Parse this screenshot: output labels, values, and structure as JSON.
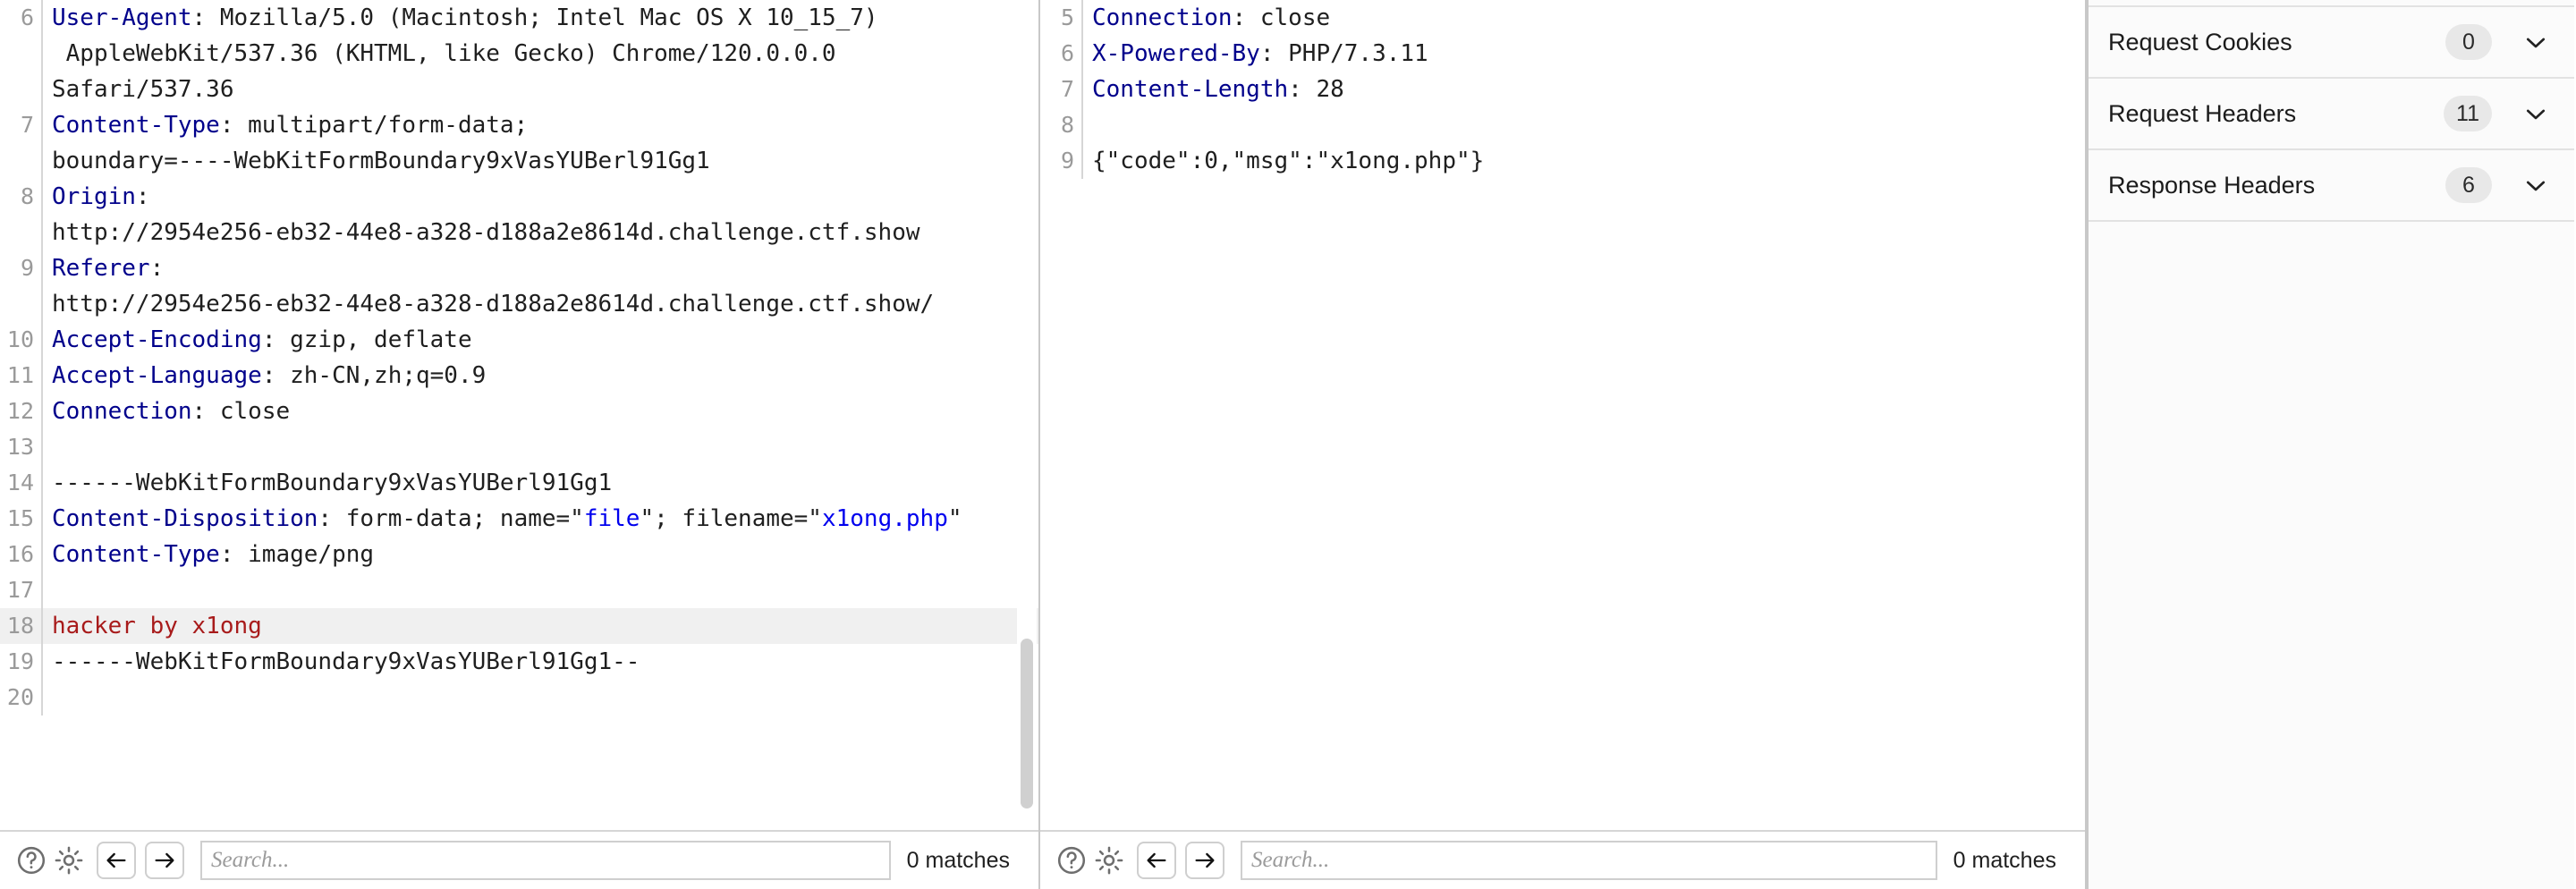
{
  "request_pane": {
    "lines": [
      {
        "num": "6",
        "segments": [
          {
            "t": "User-Agent",
            "c": "hdr"
          },
          {
            "t": ": Mozilla/5.0 (Macintosh; Intel Mac OS X 10_15_7)\n AppleWebKit/537.36 (KHTML, like Gecko) Chrome/120.0.0.0\nSafari/537.36",
            "c": "plain"
          }
        ]
      },
      {
        "num": "7",
        "segments": [
          {
            "t": "Content-Type",
            "c": "hdr"
          },
          {
            "t": ": multipart/form-data;\nboundary=----WebKitFormBoundary9xVasYUBerl91Gg1",
            "c": "plain"
          }
        ]
      },
      {
        "num": "8",
        "segments": [
          {
            "t": "Origin",
            "c": "hdr"
          },
          {
            "t": ":\nhttp://2954e256-eb32-44e8-a328-d188a2e8614d.challenge.ctf.show",
            "c": "plain"
          }
        ]
      },
      {
        "num": "9",
        "segments": [
          {
            "t": "Referer",
            "c": "hdr"
          },
          {
            "t": ":\nhttp://2954e256-eb32-44e8-a328-d188a2e8614d.challenge.ctf.show/",
            "c": "plain"
          }
        ]
      },
      {
        "num": "10",
        "segments": [
          {
            "t": "Accept-Encoding",
            "c": "hdr"
          },
          {
            "t": ": gzip, deflate",
            "c": "plain"
          }
        ]
      },
      {
        "num": "11",
        "segments": [
          {
            "t": "Accept-Language",
            "c": "hdr"
          },
          {
            "t": ": zh-CN,zh;q=0.9",
            "c": "plain"
          }
        ]
      },
      {
        "num": "12",
        "segments": [
          {
            "t": "Connection",
            "c": "hdr"
          },
          {
            "t": ": close",
            "c": "plain"
          }
        ]
      },
      {
        "num": "13",
        "segments": [
          {
            "t": "",
            "c": "plain"
          }
        ]
      },
      {
        "num": "14",
        "segments": [
          {
            "t": "------WebKitFormBoundary9xVasYUBerl91Gg1",
            "c": "plain"
          }
        ]
      },
      {
        "num": "15",
        "segments": [
          {
            "t": "Content-Disposition",
            "c": "hdr"
          },
          {
            "t": ": form-data; name=\"",
            "c": "plain"
          },
          {
            "t": "file",
            "c": "str"
          },
          {
            "t": "\"; filename=\"",
            "c": "plain"
          },
          {
            "t": "x1ong.php",
            "c": "str"
          },
          {
            "t": "\"",
            "c": "plain"
          }
        ]
      },
      {
        "num": "16",
        "segments": [
          {
            "t": "Content-Type",
            "c": "hdr"
          },
          {
            "t": ": image/png",
            "c": "plain"
          }
        ]
      },
      {
        "num": "17",
        "segments": [
          {
            "t": "",
            "c": "plain"
          }
        ]
      },
      {
        "num": "18",
        "highlight": true,
        "segments": [
          {
            "t": "hacker by x1ong",
            "c": "red"
          }
        ]
      },
      {
        "num": "19",
        "segments": [
          {
            "t": "------WebKitFormBoundary9xVasYUBerl91Gg1--",
            "c": "plain"
          }
        ]
      },
      {
        "num": "20",
        "segments": [
          {
            "t": "",
            "c": "plain"
          }
        ]
      }
    ],
    "toolbar": {
      "help_icon": "question-circle-icon",
      "settings_icon": "gear-icon",
      "prev_icon": "arrow-left-icon",
      "next_icon": "arrow-right-icon",
      "search_placeholder": "Search...",
      "search_value": "",
      "matches_label": "0 matches"
    }
  },
  "response_pane": {
    "lines": [
      {
        "num": "5",
        "segments": [
          {
            "t": "Connection",
            "c": "hdr"
          },
          {
            "t": ": close",
            "c": "plain"
          }
        ]
      },
      {
        "num": "6",
        "segments": [
          {
            "t": "X-Powered-By",
            "c": "hdr"
          },
          {
            "t": ": PHP/7.3.11",
            "c": "plain"
          }
        ]
      },
      {
        "num": "7",
        "segments": [
          {
            "t": "Content-Length",
            "c": "hdr"
          },
          {
            "t": ": 28",
            "c": "plain"
          }
        ]
      },
      {
        "num": "8",
        "segments": [
          {
            "t": "",
            "c": "plain"
          }
        ]
      },
      {
        "num": "9",
        "segments": [
          {
            "t": "{\"code\":0,\"msg\":\"x1ong.php\"}",
            "c": "plain"
          }
        ]
      }
    ],
    "toolbar": {
      "help_icon": "question-circle-icon",
      "settings_icon": "gear-icon",
      "prev_icon": "arrow-left-icon",
      "next_icon": "arrow-right-icon",
      "search_placeholder": "Search...",
      "search_value": "",
      "matches_label": "0 matches"
    }
  },
  "sidebar": {
    "sections": [
      {
        "label": "Request Cookies",
        "count": "0",
        "chevron": "chevron-down-icon"
      },
      {
        "label": "Request Headers",
        "count": "11",
        "chevron": "chevron-down-icon"
      },
      {
        "label": "Response Headers",
        "count": "6",
        "chevron": "chevron-down-icon"
      }
    ]
  },
  "colors": {
    "header_key": "#00008b",
    "string_value": "#0000ee",
    "highlight_text": "#a81b1b",
    "highlight_bg": "#f0f0f0",
    "border": "#c8c8c8"
  }
}
